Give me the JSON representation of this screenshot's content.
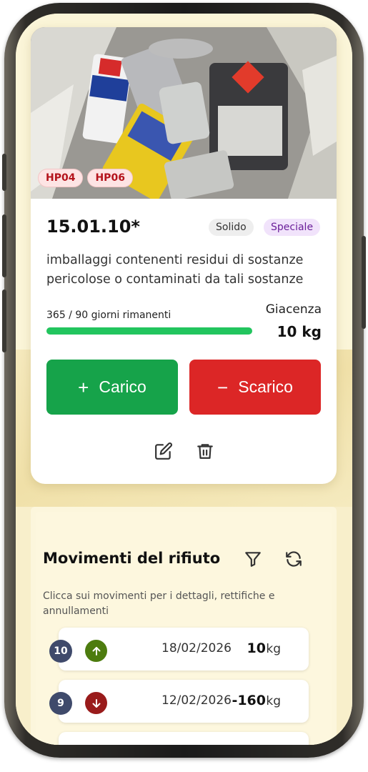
{
  "waste": {
    "hazard_tags": [
      "HP04",
      "HP06"
    ],
    "code": "15.01.10*",
    "state_badge": "Solido",
    "category_badge": "Speciale",
    "description": "imballaggi contenenti residui di sostanze pericolose o contaminati da tali sostanze",
    "days_label": "365 / 90 giorni rimanenti",
    "progress_fraction": 1.0,
    "stock_label": "Giacenza",
    "stock_value": "10 kg"
  },
  "actions": {
    "load_symbol": "+",
    "load_label": "Carico",
    "unload_symbol": "−",
    "unload_label": "Scarico",
    "edit_icon": "edit-icon",
    "delete_icon": "trash-icon"
  },
  "movements": {
    "title": "Movimenti del rifiuto",
    "hint": "Clicca sui movimenti per i dettagli, rettifiche e annullamenti",
    "rows": [
      {
        "number": "10",
        "direction": "up",
        "date": "18/02/2026",
        "quantity": "10",
        "unit": "kg"
      },
      {
        "number": "9",
        "direction": "down",
        "date": "12/02/2026",
        "quantity": "-160",
        "unit": "kg"
      }
    ]
  },
  "colors": {
    "load": "#16a34a",
    "unload": "#dc2626",
    "progress": "#22c55e",
    "hazard_tag": "#b4141c",
    "up": "#4d7c0f",
    "down": "#991b1b"
  }
}
